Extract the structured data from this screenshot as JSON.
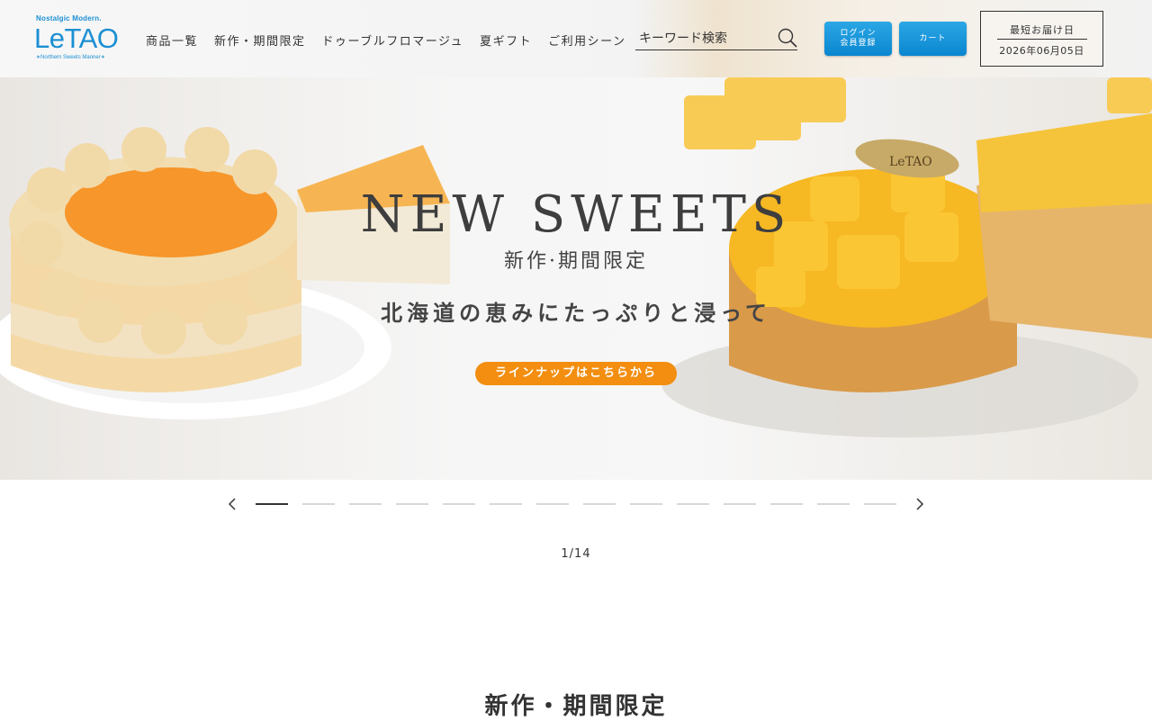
{
  "logo": {
    "tagline": "Nostalgic Modern.",
    "wordmark": "LeTAO",
    "subline": "∗Northern Sweets Manner∗"
  },
  "nav": [
    {
      "label": "商品一覧"
    },
    {
      "label": "新作・期間限定"
    },
    {
      "label": "ドゥーブルフロマージュ"
    },
    {
      "label": "夏ギフト"
    },
    {
      "label": "ご利用シーン"
    }
  ],
  "search": {
    "placeholder": "キーワード検索",
    "icon": "search-icon"
  },
  "login_button": {
    "line1": "ログイン",
    "line2": "会員登録"
  },
  "cart_button": {
    "label": "カート"
  },
  "delivery": {
    "label": "最短お届け日",
    "date": "2026年06月05日"
  },
  "hero": {
    "title": "NEW SWEETS",
    "subtitle": "新作·期間限定",
    "catch": "北海道の恵みにたっぷりと浸って",
    "cta": "ラインナップはこちらから",
    "plaque": "LeTAO",
    "colors": {
      "cta": "#f38e10",
      "mango": "#f6b823",
      "orange_glaze": "#f7962a"
    }
  },
  "slider": {
    "prev_icon": "chevron-left-icon",
    "next_icon": "chevron-right-icon",
    "current": 1,
    "total": 14,
    "counter": "1/14"
  },
  "section": {
    "title": "新作・期間限定"
  }
}
